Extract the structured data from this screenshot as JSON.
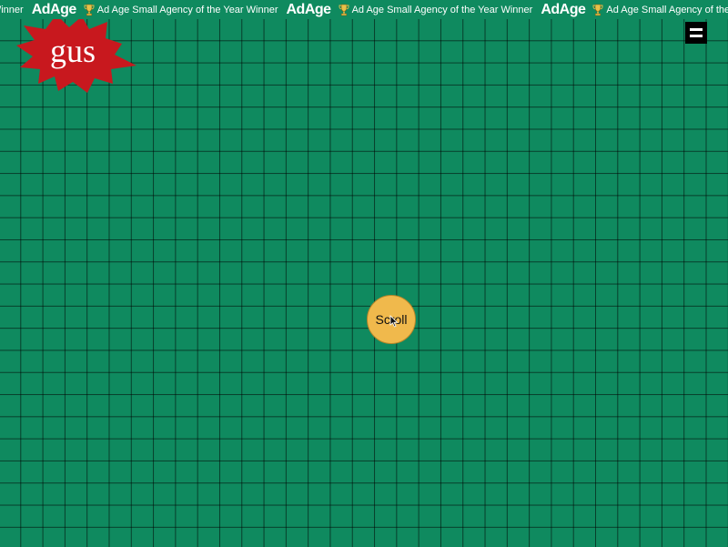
{
  "ticker": {
    "items": [
      {
        "text": "ar Winner",
        "has_logo": true,
        "logo": "AdAge"
      },
      {
        "text": "Ad Age Small Agency of the Year Winner",
        "has_logo": true,
        "logo": "AdAge"
      },
      {
        "text": "Ad Age Small Agency of the Year Winner",
        "has_logo": true,
        "logo": "AdAge"
      },
      {
        "text": "Ad Age Small Agency of the Year Winner",
        "has_logo": false,
        "logo": ""
      }
    ],
    "trophy_icon": "trophy-icon"
  },
  "logo": {
    "text": "gus",
    "badge_color": "#c8181e",
    "icon": "starburst-badge-icon"
  },
  "menu": {
    "icon": "hamburger-menu-icon"
  },
  "scroll_button": {
    "label": "Scroll",
    "color": "#f0b94c"
  },
  "colors": {
    "background": "#0f8a5f",
    "grid_lines": "#0a3a28"
  },
  "cursor": {
    "icon": "pointer-cursor-icon"
  }
}
